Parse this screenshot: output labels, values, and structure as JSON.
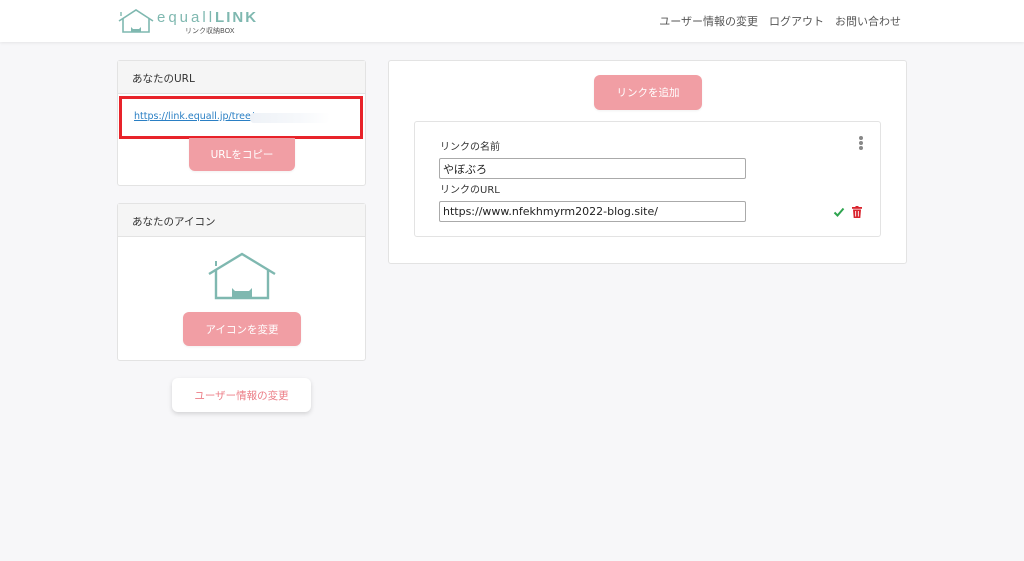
{
  "header": {
    "logo_main": "equall",
    "logo_bold": "LINK",
    "logo_sub": "リンク収納BOX",
    "nav": [
      "ユーザー情報の変更",
      "ログアウト",
      "お問い合わせ"
    ]
  },
  "url_card": {
    "title": "あなたのURL",
    "url": "https://link.equall.jp/tree/",
    "copy_button": "URLをコピー"
  },
  "icon_card": {
    "title": "あなたのアイコン",
    "change_button": "アイコンを変更"
  },
  "profile_button": "ユーザー情報の変更",
  "links": {
    "add_button": "リンクを追加",
    "name_label": "リンクの名前",
    "name_value": "やぼぶろ",
    "url_label": "リンクのURL",
    "url_value": "https://www.nfekhmyrm2022-blog.site/"
  },
  "colors": {
    "accent_pink": "#f19ea4",
    "logo_teal": "#7fb8b0",
    "highlight_red": "#e8232a",
    "link_blue": "#2a7fc4",
    "check_green": "#2ea44f",
    "trash_red": "#d9232d"
  },
  "icons": [
    "house-cat-logo-icon",
    "kebab-menu-icon",
    "check-icon",
    "trash-icon"
  ]
}
